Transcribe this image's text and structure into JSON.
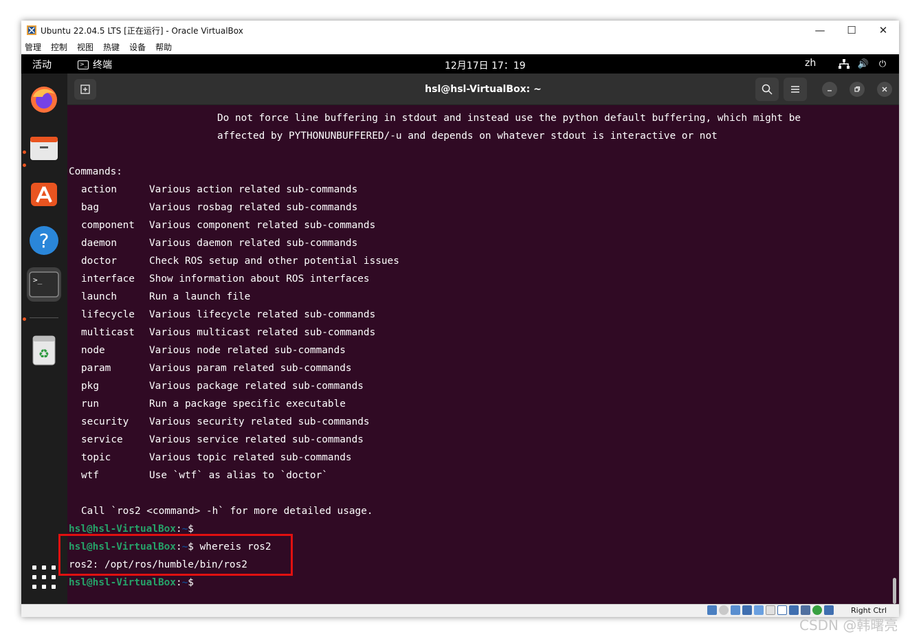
{
  "window": {
    "title": "Ubuntu 22.04.5 LTS [正在运行] - Oracle VirtualBox",
    "controls": {
      "minimize": "—",
      "maximize": "☐",
      "close": "✕"
    }
  },
  "menubar": [
    "管理",
    "控制",
    "视图",
    "热键",
    "设备",
    "帮助"
  ],
  "topbar": {
    "activities": "活动",
    "app_name": "终端",
    "clock": "12月17日 17：19",
    "input_lang": "zh"
  },
  "terminal": {
    "title": "hsl@hsl-VirtualBox: ~",
    "intro_lines": [
      "Do not force line buffering in stdout and instead use the python default buffering, which might be",
      "affected by PYTHONUNBUFFERED/-u and depends on whatever stdout is interactive or not"
    ],
    "commands_header": "Commands:",
    "commands": [
      {
        "name": "action",
        "desc": "Various action related sub-commands"
      },
      {
        "name": "bag",
        "desc": "Various rosbag related sub-commands"
      },
      {
        "name": "component",
        "desc": "Various component related sub-commands"
      },
      {
        "name": "daemon",
        "desc": "Various daemon related sub-commands"
      },
      {
        "name": "doctor",
        "desc": "Check ROS setup and other potential issues"
      },
      {
        "name": "interface",
        "desc": "Show information about ROS interfaces"
      },
      {
        "name": "launch",
        "desc": "Run a launch file"
      },
      {
        "name": "lifecycle",
        "desc": "Various lifecycle related sub-commands"
      },
      {
        "name": "multicast",
        "desc": "Various multicast related sub-commands"
      },
      {
        "name": "node",
        "desc": "Various node related sub-commands"
      },
      {
        "name": "param",
        "desc": "Various param related sub-commands"
      },
      {
        "name": "pkg",
        "desc": "Various package related sub-commands"
      },
      {
        "name": "run",
        "desc": "Run a package specific executable"
      },
      {
        "name": "security",
        "desc": "Various security related sub-commands"
      },
      {
        "name": "service",
        "desc": "Various service related sub-commands"
      },
      {
        "name": "topic",
        "desc": "Various topic related sub-commands"
      },
      {
        "name": "wtf",
        "desc": "Use `wtf` as alias to `doctor`"
      }
    ],
    "usage_line": "Call `ros2 <command> -h` for more detailed usage.",
    "prompt_user": "hsl@hsl-VirtualBox",
    "prompt_sep": ":",
    "prompt_path": "~",
    "prompt_symbol": "$",
    "command_entered": " whereis ros2",
    "command_output": "ros2: /opt/ros/humble/bin/ros2"
  },
  "statusbar": {
    "host_key": "Right Ctrl"
  },
  "watermark": "CSDN @韩曙亮",
  "colors": {
    "terminal_bg": "#300a24",
    "prompt_user": "#26a269",
    "prompt_path": "#12488b",
    "highlight": "#e01010"
  }
}
